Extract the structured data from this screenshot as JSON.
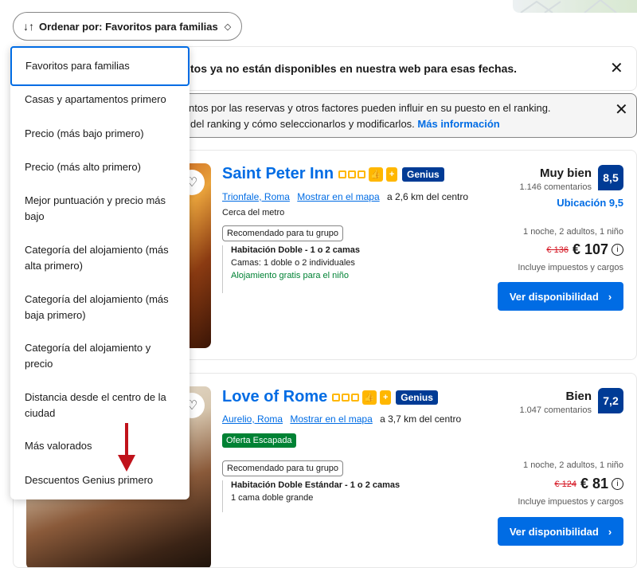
{
  "sort": {
    "label": "Ordenar por: Favoritos para familias",
    "arrows_icon": "sort-arrows-icon",
    "chevron_icon": "chevron-updown-icon"
  },
  "dropdown": {
    "items": [
      "Favoritos para familias",
      "Casas y apartamentos primero",
      "Precio (más bajo primero)",
      "Precio (más alto primero)",
      "Mejor puntuación y precio más bajo",
      "Categoría del alojamiento (más alta primero)",
      "Categoría del alojamiento (más baja primero)",
      "Categoría del alojamiento y precio",
      "Distancia desde el centro de la ciudad",
      "Más valorados",
      "Descuentos Genius primero"
    ],
    "selected": "Favoritos para familias"
  },
  "banner1": {
    "text": "tos ya no están disponibles en nuestra web para esas fechas."
  },
  "banner2": {
    "line1": "ntos por las reservas y otros factores pueden influir en su puesto en el ranking.",
    "line2": "del ranking y cómo seleccionarlos y modificarlos.",
    "link": "Más información"
  },
  "cards": [
    {
      "name": "Saint Peter Inn",
      "genius": "Genius",
      "district": "Trionfale, Roma",
      "map_link": "Mostrar en el mapa",
      "distance": "a 2,6 km del centro",
      "note": "Cerca del metro",
      "recommended": "Recomendado para tu grupo",
      "room_name": "Habitación Doble - 1 o 2 camas",
      "room_beds": "Camas: 1 doble o 2 individuales",
      "room_extra": "Alojamiento gratis para el niño",
      "rating_word": "Muy bien",
      "reviews": "1.146 comentarios",
      "score": "8,5",
      "location_score": "Ubicación 9,5",
      "stay": "1 noche, 2 adultos, 1 niño",
      "old_price": "€ 136",
      "new_price": "€ 107",
      "taxes": "Incluye impuestos y cargos",
      "cta": "Ver disponibilidad"
    },
    {
      "name": "Love of Rome",
      "genius": "Genius",
      "district": "Aurelio, Roma",
      "map_link": "Mostrar en el mapa",
      "distance": "a 3,7 km del centro",
      "deal": "Oferta Escapada",
      "recommended": "Recomendado para tu grupo",
      "room_name": "Habitación Doble Estándar - 1 o 2 camas",
      "room_beds": "1 cama doble grande",
      "rating_word": "Bien",
      "reviews": "1.047 comentarios",
      "score": "7,2",
      "stay": "1 noche, 2 adultos, 1 niño",
      "old_price": "€ 124",
      "new_price": "€ 81",
      "taxes": "Incluye impuestos y cargos",
      "cta": "Ver disponibilidad"
    }
  ],
  "colors": {
    "primary": "#006ce4",
    "genius": "#003b95",
    "star": "#ffb700",
    "deal": "#008234",
    "strike": "#d4111e",
    "annotation_arrow": "#c0121b"
  }
}
